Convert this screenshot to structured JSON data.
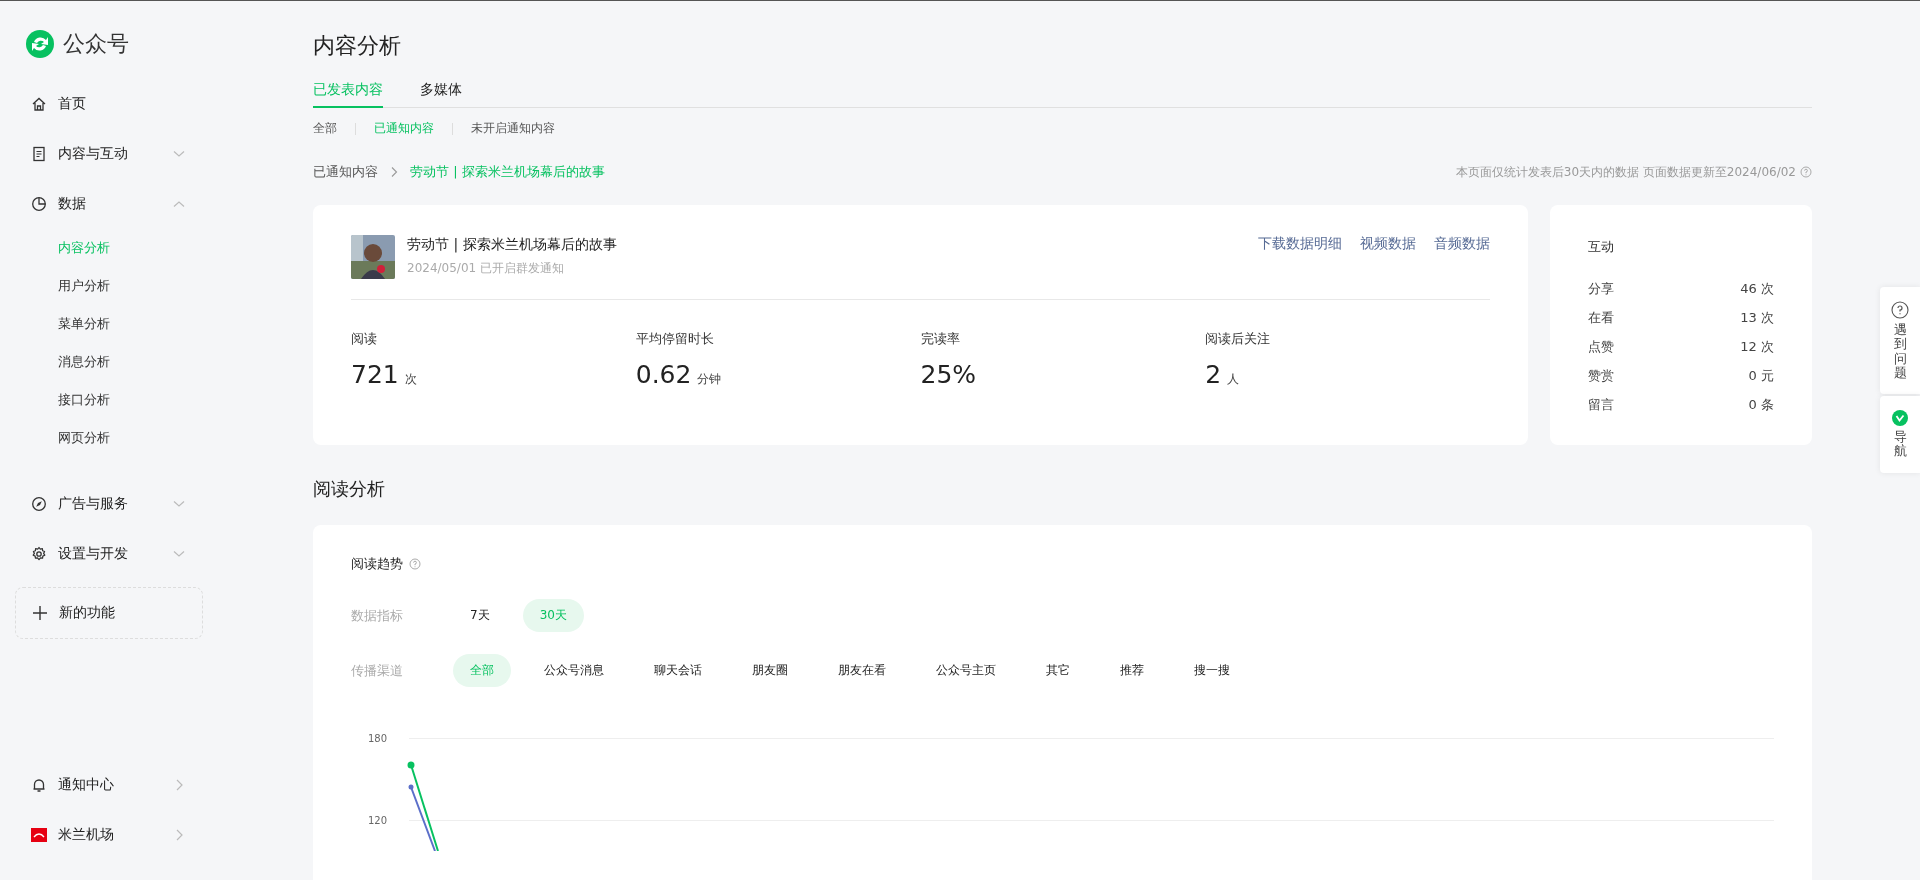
{
  "brand": {
    "name": "公众号"
  },
  "sidebar": {
    "items": [
      {
        "label": "首页"
      },
      {
        "label": "内容与互动",
        "expanded": false
      },
      {
        "label": "数据",
        "expanded": true,
        "children": [
          {
            "label": "内容分析",
            "selected": true
          },
          {
            "label": "用户分析",
            "selected": false
          },
          {
            "label": "菜单分析",
            "selected": false
          },
          {
            "label": "消息分析",
            "selected": false
          },
          {
            "label": "接口分析",
            "selected": false
          },
          {
            "label": "网页分析",
            "selected": false
          }
        ]
      },
      {
        "label": "广告与服务",
        "expanded": false
      },
      {
        "label": "设置与开发",
        "expanded": false
      }
    ],
    "new_feature": "新的功能",
    "bottom_items": [
      {
        "label": "通知中心"
      },
      {
        "label": "米兰机场"
      }
    ]
  },
  "page": {
    "title": "内容分析",
    "tabs": [
      {
        "label": "已发表内容",
        "selected": true
      },
      {
        "label": "多媒体",
        "selected": false
      }
    ],
    "subtabs": [
      {
        "label": "全部",
        "selected": false
      },
      {
        "label": "已通知内容",
        "selected": true
      },
      {
        "label": "未开启通知内容",
        "selected": false
      }
    ],
    "breadcrumb": [
      "已通知内容",
      "劳动节 | 探索米兰机场幕后的故事"
    ],
    "note": "本页面仅统计发表后30天内的数据 页面数据更新至2024/06/02"
  },
  "article": {
    "title": "劳动节 | 探索米兰机场幕后的故事",
    "meta": "2024/05/01 已开启群发通知",
    "links": [
      "下载数据明细",
      "视频数据",
      "音频数据"
    ],
    "metrics": [
      {
        "label": "阅读",
        "value": "721",
        "unit": "次"
      },
      {
        "label": "平均停留时长",
        "value": "0.62",
        "unit": "分钟"
      },
      {
        "label": "完读率",
        "value": "25%"
      },
      {
        "label": "阅读后关注",
        "value": "2",
        "unit": "人"
      }
    ]
  },
  "interaction": {
    "title": "互动",
    "rows": [
      {
        "label": "分享",
        "value": "46 次"
      },
      {
        "label": "在看",
        "value": "13 次"
      },
      {
        "label": "点赞",
        "value": "12 次"
      },
      {
        "label": "赞赏",
        "value": "0 元"
      },
      {
        "label": "留言",
        "value": "0 条"
      }
    ]
  },
  "reading": {
    "section_title": "阅读分析",
    "card_title": "阅读趋势",
    "metric_label": "数据指标",
    "ranges": [
      {
        "label": "7天",
        "selected": false
      },
      {
        "label": "30天",
        "selected": true
      }
    ],
    "channel_label": "传播渠道",
    "channels": [
      {
        "label": "全部",
        "selected": true
      },
      {
        "label": "公众号消息",
        "selected": false
      },
      {
        "label": "聊天会话",
        "selected": false
      },
      {
        "label": "朋友圈",
        "selected": false
      },
      {
        "label": "朋友在看",
        "selected": false
      },
      {
        "label": "公众号主页",
        "selected": false
      },
      {
        "label": "其它",
        "selected": false
      },
      {
        "label": "推荐",
        "selected": false
      },
      {
        "label": "搜一搜",
        "selected": false
      }
    ],
    "y_axis_labels": [
      "180",
      "120"
    ]
  },
  "float_panel": [
    {
      "label": "遇到问题"
    },
    {
      "label": "导航"
    }
  ]
}
